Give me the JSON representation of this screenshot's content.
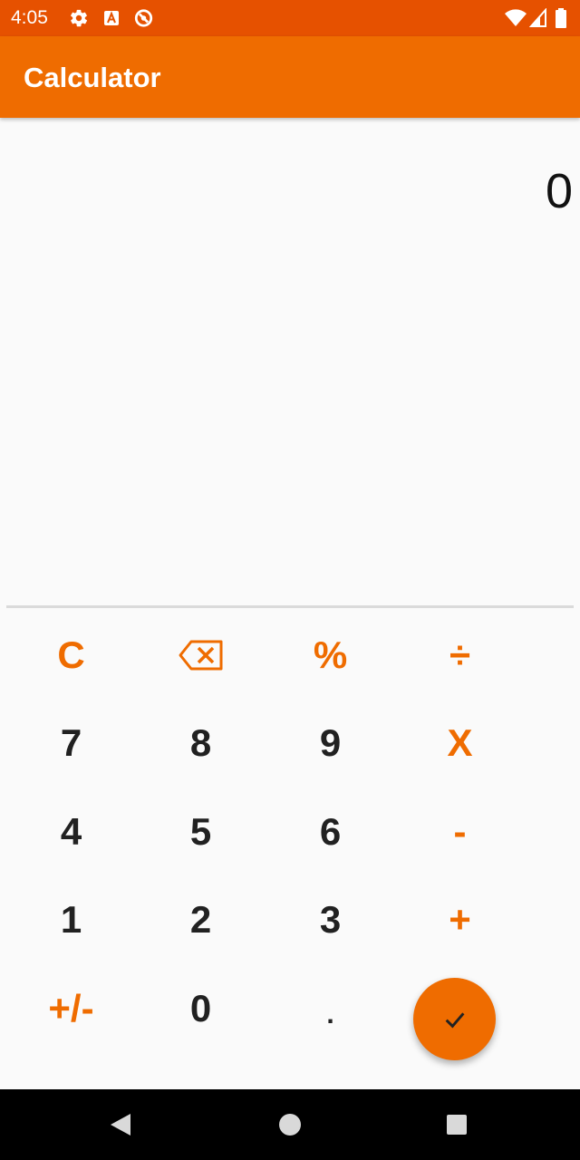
{
  "status_bar": {
    "time": "4:05",
    "icons_left": [
      "settings-icon",
      "font-icon",
      "blocked-icon"
    ],
    "icons_right": [
      "wifi-icon",
      "cell-signal-icon",
      "battery-icon"
    ]
  },
  "app_bar": {
    "title": "Calculator",
    "color": "#ef6c00"
  },
  "display": {
    "value": "0"
  },
  "keypad": {
    "row1": [
      "C",
      "⌫",
      "%",
      "÷"
    ],
    "row2": [
      "7",
      "8",
      "9",
      "X"
    ],
    "row3": [
      "4",
      "5",
      "6",
      "-"
    ],
    "row4": [
      "1",
      "2",
      "3",
      "+"
    ],
    "row5": [
      "+/-",
      "0",
      "."
    ],
    "fab_icon": "check-icon"
  },
  "colors": {
    "accent": "#ef6c00",
    "status_bar": "#e65100",
    "background": "#fafafa"
  },
  "nav_bar": {
    "icons": [
      "back-icon",
      "home-icon",
      "recents-icon"
    ]
  }
}
